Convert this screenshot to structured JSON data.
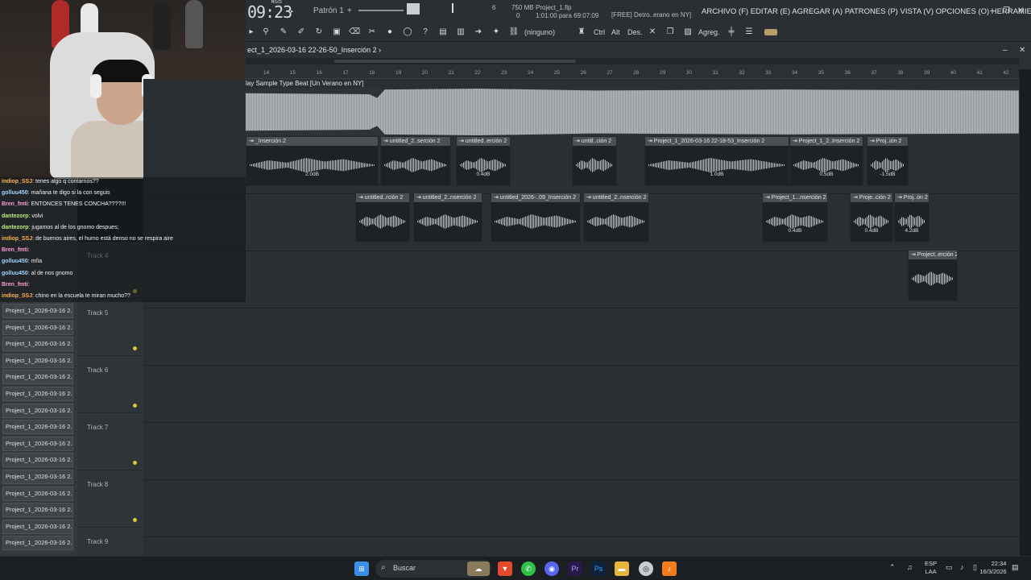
{
  "topbar": {
    "clock": "09:23",
    "clock_small": "M:S:CS",
    "pattern": "Patrón 1",
    "project_file": "Project_1.flp",
    "time_info": "1:01:00 para 69:07:09",
    "mem": "750 MB",
    "mem_value": "0",
    "cpu": "6",
    "hint": "[FREE] Detro..erano en NY]",
    "menu": "ARCHIVO (F) EDITAR (E) AGREGAR (A) PATRONES (P) VISTA (V) OPCIONES (O) HERRAMIENTAS (T) AYUDA",
    "win_min": "–",
    "win_max": "❐",
    "win_close": "✕"
  },
  "toolbar": {
    "snap": "(ninguno)",
    "ctrl": "Ctrl",
    "alt": "Alt",
    "des": "Des.",
    "agreg": "Agreg."
  },
  "playlist": {
    "title": "ect_1_2026-03-16 22-26-50_Inserción 2 ›",
    "master_name": "lay Sample Type Beat [Un Verano en NY]",
    "ruler": [
      "14",
      "15",
      "16",
      "17",
      "18",
      "19",
      "20",
      "21",
      "22",
      "23",
      "24",
      "25",
      "26",
      "27",
      "28",
      "29",
      "30",
      "31",
      "32",
      "33",
      "34",
      "35",
      "36",
      "37",
      "38",
      "39",
      "40",
      "41",
      "42"
    ]
  },
  "clips": {
    "row1": [
      {
        "name": "_Inserción 2",
        "gain": "2.0dB"
      },
      {
        "name": "untitled_2..serción 2",
        "gain": ""
      },
      {
        "name": "untitled..erción 2",
        "gain": "0.4dB"
      },
      {
        "name": "untitl..ción 2",
        "gain": ""
      },
      {
        "name": "Project_1_2026-03-16 22-18-53_Inserción 2",
        "gain": "1.0dB"
      },
      {
        "name": "Project_1_2..Inserción 2",
        "gain": "0.5dB"
      },
      {
        "name": "Proj..ión 2",
        "gain": "-1.5dB"
      }
    ],
    "row2": [
      {
        "name": "untitled..rción 2",
        "gain": ""
      },
      {
        "name": "untitled_2..nserción 2",
        "gain": ""
      },
      {
        "name": "untitled_2026-..09_Inserción 2",
        "gain": ""
      },
      {
        "name": "untitled_2..nserción 2",
        "gain": ""
      },
      {
        "name": "Project_1...nserción 2",
        "gain": "0.4dB"
      },
      {
        "name": "Proje..ción 2",
        "gain": "0.4dB"
      },
      {
        "name": "Proj..ón 2",
        "gain": "4.2dB"
      }
    ],
    "row3": [
      {
        "name": "Project..erción 2",
        "gain": ""
      }
    ]
  },
  "tracks": [
    "Track 4",
    "Track 5",
    "Track 6",
    "Track 7",
    "Track 8",
    "Track 9"
  ],
  "browser": {
    "items": [
      "Project_1_2026-03-16 2..",
      "Project_1_2026-03-16 2..",
      "Project_1_2026-03-16 2..",
      "Project_1_2026-03-16 2..",
      "Project_1_2026-03-16 2..",
      "Project_1_2026-03-16 2..",
      "Project_1_2026-03-16 2..",
      "Project_1_2026-03-16 2..",
      "Project_1_2026-03-16 2..",
      "Project_1_2026-03-16 2..",
      "Project_1_2026-03-16 2..",
      "Project_1_2026-03-16 2..",
      "Project_1_2026-03-16 2..",
      "Project_1_2026-03-16 2..",
      "Project_1_2026-03-16 2.."
    ]
  },
  "chat": [
    {
      "user": "indiop_SSJ",
      "text": ": tenes algo q contarnos??",
      "cls": "u1"
    },
    {
      "user": "golluu450",
      "text": ": mañana te digo si la con seguis",
      "cls": "u2"
    },
    {
      "user": "Bren_fmti",
      "text": ": ENTONCES TENES CONCHA????!!!",
      "cls": "u3"
    },
    {
      "user": "dantezorp",
      "text": ": volvi",
      "cls": "u4"
    },
    {
      "user": "dantezorp",
      "text": ": jugamos al de los gnomo despues;",
      "cls": "u4"
    },
    {
      "user": "indiop_SSJ",
      "text": ": de buenos aires, el humo está denso no se respira aire",
      "cls": "u1"
    },
    {
      "user": "Bren_fmti",
      "text": ":",
      "cls": "u3"
    },
    {
      "user": "golluu450",
      "text": ": mña",
      "cls": "u2"
    },
    {
      "user": "golluu450",
      "text": ": al de nos gnomo",
      "cls": "u2"
    },
    {
      "user": "Bren_fmti",
      "text": ":",
      "cls": "u3"
    },
    {
      "user": "indiop_SSJ",
      "text": ": chino en la escuela te miran mucho??",
      "cls": "u1"
    }
  ],
  "taskbar": {
    "search": "Buscar",
    "lang": "ESP",
    "lang2": "LAA",
    "time": "22:34",
    "date": "16/3/2026"
  },
  "colors": {
    "accent": "#d8c93a",
    "bg": "#2a2f33"
  }
}
